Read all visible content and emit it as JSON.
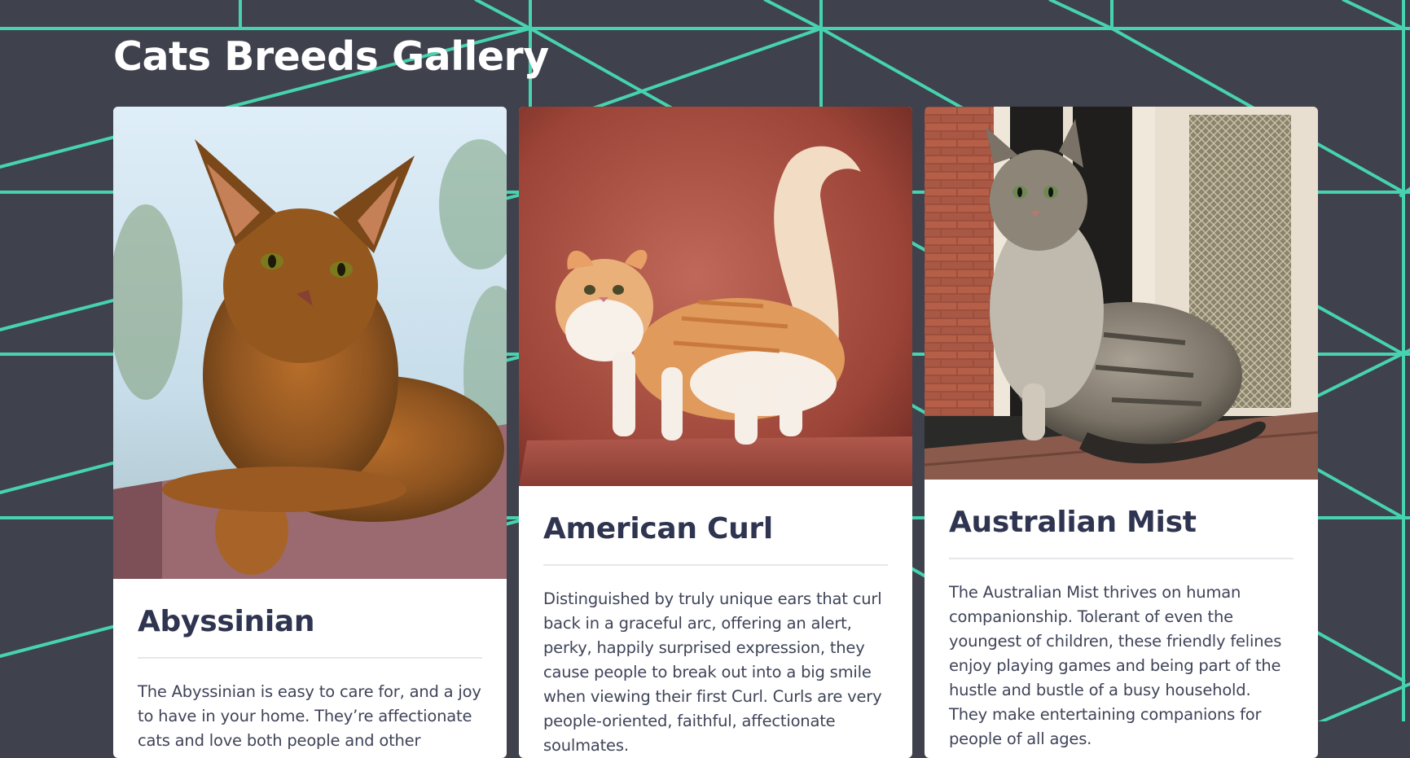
{
  "page": {
    "title": "Cats Breeds Gallery"
  },
  "colors": {
    "background": "#3f414d",
    "accent_lines": "#46d3ae",
    "card_background": "#ffffff",
    "card_title": "#2f3550",
    "card_text": "#3f4458"
  },
  "breeds": [
    {
      "name": "Abyssinian",
      "description": "The Abyssinian is easy to care for, and a joy to have in your home. They’re affectionate cats and love both people and other animals."
    },
    {
      "name": "American Curl",
      "description": "Distinguished by truly unique ears that curl back in a graceful arc, offering an alert, perky, happily surprised expression, they cause people to break out into a big smile when viewing their first Curl. Curls are very people-oriented, faithful, affectionate soulmates."
    },
    {
      "name": "Australian Mist",
      "description": "The Australian Mist thrives on human companionship. Tolerant of even the youngest of children, these friendly felines enjoy playing games and being part of the hustle and bustle of a busy household. They make entertaining companions for people of all ages."
    }
  ]
}
